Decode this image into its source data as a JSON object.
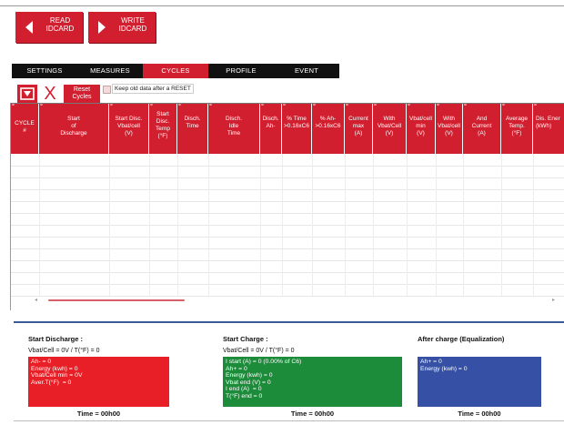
{
  "toolbar": {
    "read_label": "READ\nIDCARD",
    "write_label": "WRITE\nIDCARD"
  },
  "tabs": [
    {
      "label": "SETTINGS"
    },
    {
      "label": "MEASURES"
    },
    {
      "label": "CYCLES",
      "active": true
    },
    {
      "label": "PROFILE"
    },
    {
      "label": "EVENT"
    }
  ],
  "actions": {
    "x_label": "X",
    "reset_label": "Reset\nCycles",
    "keep_label": "Keep old data after a RESET"
  },
  "table": {
    "header_mark": "=",
    "columns": [
      "CYCLE\n#",
      "Start\nof\nDischarge",
      "Start Disc.\nVbat/cell\n(V)",
      "Start\nDisc.\nTemp\n(°F)",
      "Disch.\nTime",
      "Disch.\nIdle\nTime",
      "Disch.\nAh-",
      "% Time\n>0.16xC6",
      "% Ah-\n>0.16xC6",
      "Current\nmax\n(A)",
      "With\nVbat/Cell\n(V)",
      "Vbat/cell\nmin\n(V)",
      "With\nVbat/cell\n(V)",
      "And\nCurrent\n(A)",
      "Average\nTemp.\n(°F)",
      "Dis. Ener\n(kWh)"
    ],
    "scroll_left": "◂",
    "scroll_right": "▸"
  },
  "summary": {
    "discharge": {
      "title": "Start Discharge :",
      "sub": "Vbat/Cell = 0V / T(°F) = 0",
      "lines": [
        "Ah- = 0",
        "Energy (kwh) = 0",
        "Vbat/Cell min = 0V",
        "Aver.T(°F)  = 0"
      ],
      "time": "Time = 00h00"
    },
    "charge": {
      "title": "Start Charge :",
      "sub": "Vbat/Cell = 0V / T(°F) = 0",
      "lines": [
        "I start (A) = 0 (0.00% of C6)",
        "Ah+ = 0",
        "Energy (kwh) = 0",
        "Vbat end (V) = 0",
        "I end (A)  = 0",
        "T(°F) end = 0"
      ],
      "time": "Time = 00h00"
    },
    "equalization": {
      "title": "After charge (Equalization)",
      "lines": [
        "Ah+ = 0",
        "Energy (kwh) = 0"
      ],
      "time": "Time = 00h00"
    }
  },
  "colors": {
    "accent": "#d21f2f",
    "discharge_box": "#e81f26",
    "charge_box": "#1c8c3b",
    "equalization_box": "#3550a4"
  }
}
